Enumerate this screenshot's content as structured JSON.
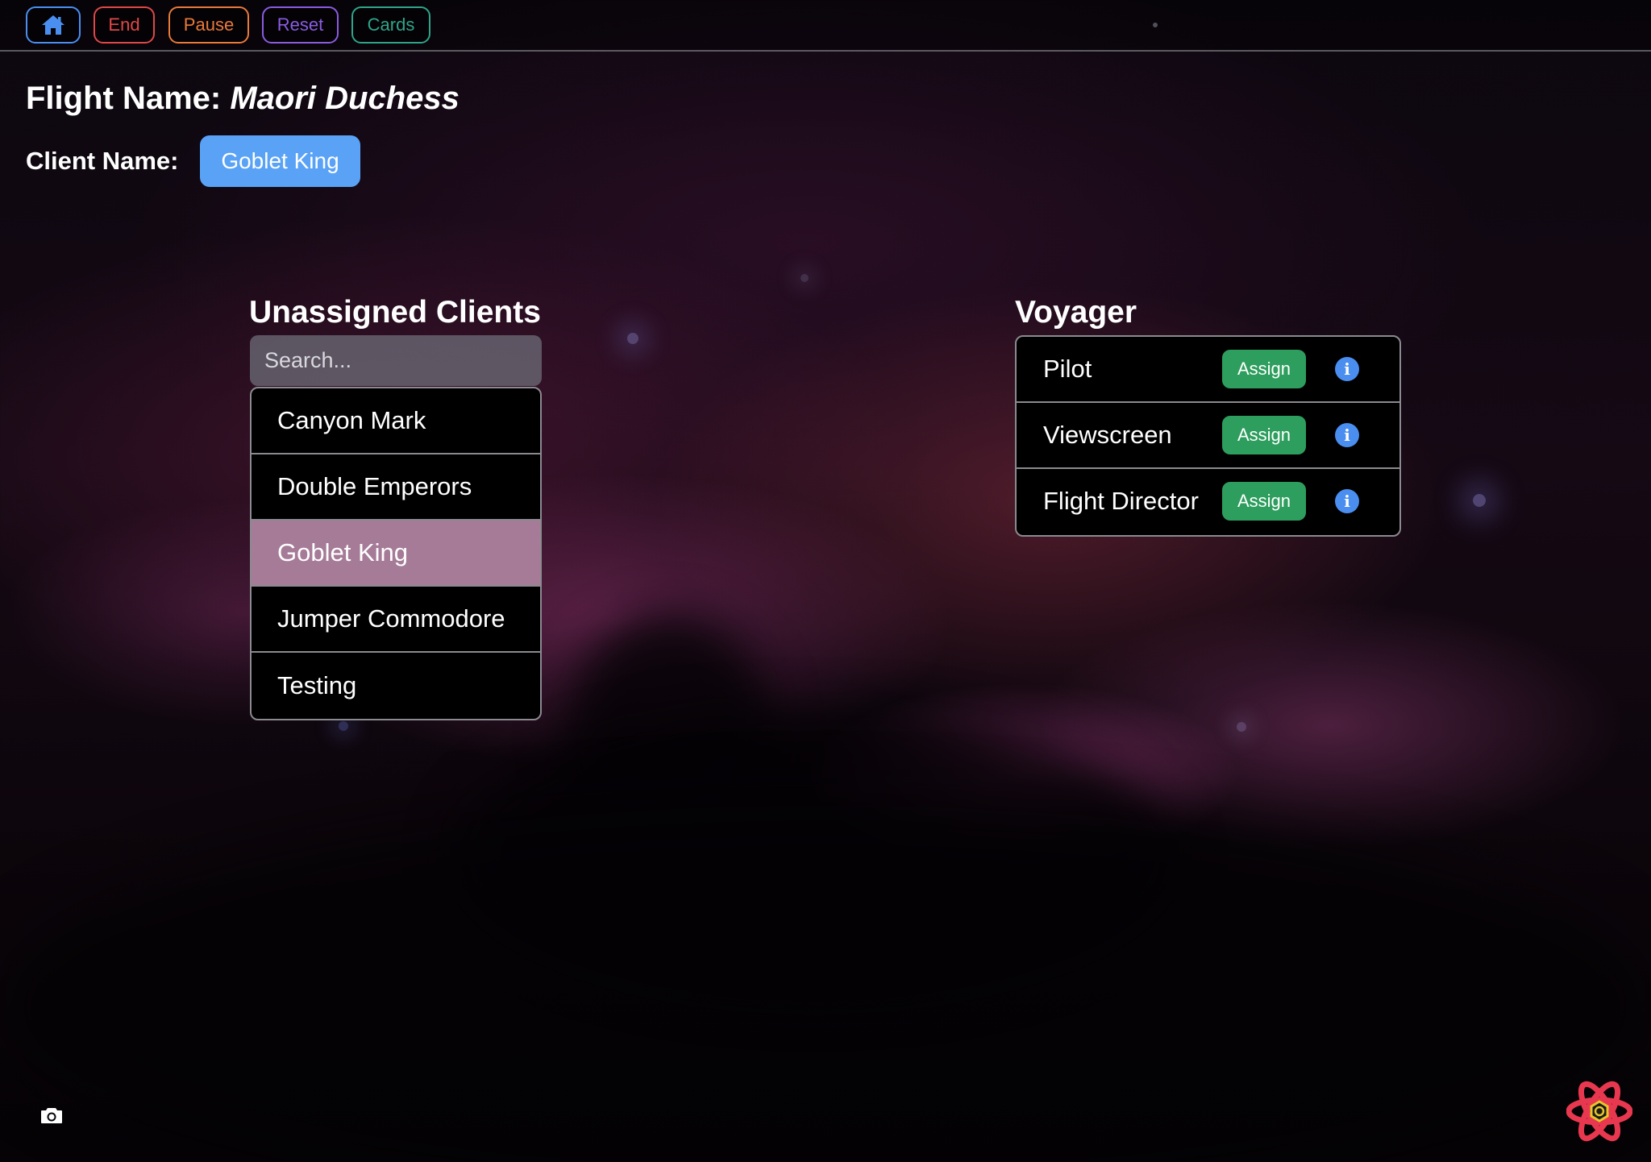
{
  "toolbar": {
    "home_icon": "home-icon",
    "end_label": "End",
    "pause_label": "Pause",
    "reset_label": "Reset",
    "cards_label": "Cards"
  },
  "header": {
    "flight_label": "Flight Name:",
    "flight_name": "Maori Duchess",
    "client_label": "Client Name:",
    "client_name": "Goblet King"
  },
  "unassigned": {
    "title": "Unassigned Clients",
    "search_placeholder": "Search...",
    "search_value": "",
    "clients": [
      {
        "name": "Canyon Mark",
        "selected": false
      },
      {
        "name": "Double Emperors",
        "selected": false
      },
      {
        "name": "Goblet King",
        "selected": true
      },
      {
        "name": "Jumper Commodore",
        "selected": false
      },
      {
        "name": "Testing",
        "selected": false
      }
    ]
  },
  "simulator": {
    "title": "Voyager",
    "assign_label": "Assign",
    "stations": [
      {
        "name": "Pilot"
      },
      {
        "name": "Viewscreen"
      },
      {
        "name": "Flight Director"
      }
    ]
  },
  "footer": {
    "camera_icon": "camera-icon",
    "logo_icon": "atom-logo-icon"
  },
  "colors": {
    "home": "#4a8ff0",
    "end": "#e04848",
    "pause": "#e87a3a",
    "reset": "#8a5ce0",
    "cards": "#2ea58a",
    "client_button": "#5aa2f5",
    "selected_row": "#a57b97",
    "assign": "#2e9e5e",
    "info": "#4a8ff0"
  }
}
